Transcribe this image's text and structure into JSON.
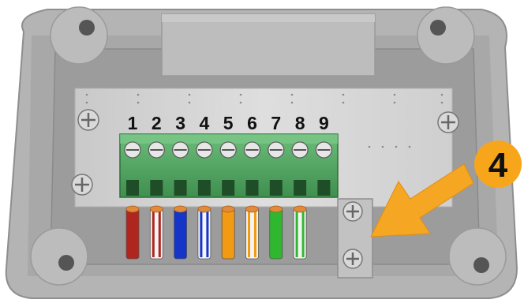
{
  "terminal_numbers": [
    "1",
    "2",
    "3",
    "4",
    "5",
    "6",
    "7",
    "8",
    "9"
  ],
  "step_badge": {
    "text": "4",
    "color": "#f7a61c"
  },
  "arrow_color": "#f5a623",
  "terminal_block_color": "#4fa560",
  "wires": [
    {
      "terminal": "1",
      "color": "red",
      "base": "#b0261f",
      "stripe": null
    },
    {
      "terminal": "2",
      "color": "white-red",
      "base": "#f4f4f4",
      "stripe": "#b0261f"
    },
    {
      "terminal": "3",
      "color": "blue",
      "base": "#1535c9",
      "stripe": null
    },
    {
      "terminal": "4",
      "color": "white-blue",
      "base": "#f4f4f4",
      "stripe": "#1535c9"
    },
    {
      "terminal": "5",
      "color": "orange",
      "base": "#f29a14",
      "stripe": null
    },
    {
      "terminal": "6",
      "color": "white-orange",
      "base": "#f4f4f4",
      "stripe": "#f29a14"
    },
    {
      "terminal": "7",
      "color": "green",
      "base": "#2fb82f",
      "stripe": null
    },
    {
      "terminal": "8",
      "color": "white-green",
      "base": "#f4f4f4",
      "stripe": "#2fb82f"
    }
  ]
}
